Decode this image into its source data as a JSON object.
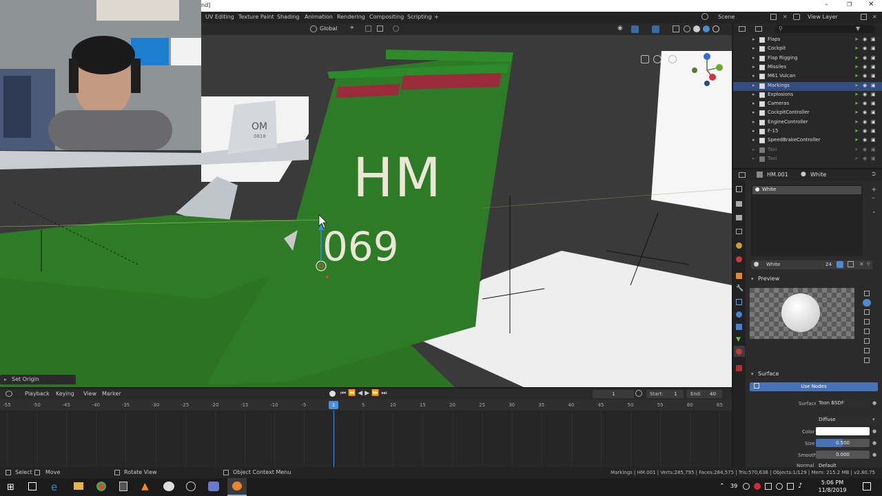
{
  "title_bar": {
    "text": "nd]"
  },
  "workspace_tabs": [
    "UV Editing",
    "Texture Paint",
    "Shading",
    "Animation",
    "Rendering",
    "Compositing",
    "Scripting",
    "+"
  ],
  "scene": {
    "scene_label": "Scene",
    "view_layer_label": "View Layer"
  },
  "viewport_header": {
    "orientation": "Global"
  },
  "viewport": {
    "decal_top": "HM",
    "decal_bottom": "069",
    "background_decal": "OM",
    "background_decal_small": "0818",
    "operator_panel": "Set Origin",
    "colors": {
      "wing_green": "#2f7a27",
      "tail_green": "#2d7a27",
      "stripe_red": "#9b2a3a",
      "decal_cream": "#ece6d6"
    }
  },
  "outliner": {
    "items": [
      {
        "label": "Flaps",
        "selected": false
      },
      {
        "label": "Cockpit",
        "selected": false
      },
      {
        "label": "Flap Rigging",
        "selected": false
      },
      {
        "label": "Missiles",
        "selected": false
      },
      {
        "label": "M61 Vulcan",
        "selected": false
      },
      {
        "label": "Markings",
        "selected": true
      },
      {
        "label": "Explosions",
        "selected": false
      },
      {
        "label": "Cameras",
        "selected": false
      },
      {
        "label": "CockpitController",
        "selected": false
      },
      {
        "label": "EngineController",
        "selected": false
      },
      {
        "label": "F-15",
        "selected": false
      },
      {
        "label": "SpeedBrakeController",
        "selected": false
      },
      {
        "label": "Taxi",
        "selected": false
      },
      {
        "label": "Taxi",
        "selected": false
      }
    ]
  },
  "properties": {
    "object_name": "HM.001",
    "material_name": "White",
    "slot_name": "White",
    "material_field": "White",
    "user_count": "24",
    "preview_label": "Preview",
    "surface_label": "Surface",
    "use_nodes_label": "Use Nodes",
    "surface_field_label": "Surface",
    "surface_value": "Toon BSDF",
    "component_value": "Diffuse",
    "color_label": "Color",
    "color_value": "#ffffff",
    "size_label": "Size",
    "size_value": "0.500",
    "size_fraction": 0.5,
    "smooth_label": "Smooth",
    "smooth_value": "0.000",
    "normal_label": "Normal",
    "normal_value": "Default"
  },
  "timeline": {
    "menus": [
      "Playback",
      "Keying",
      "View",
      "Marker"
    ],
    "current_frame": "1",
    "start_label": "Start:",
    "start_value": "1",
    "end_label": "End:",
    "end_value": "40",
    "ticks": [
      "-55",
      "-50",
      "-45",
      "-40",
      "-35",
      "-30",
      "-25",
      "-20",
      "-15",
      "-10",
      "-5",
      "1",
      "5",
      "10",
      "15",
      "20",
      "25",
      "30",
      "35",
      "40",
      "45",
      "50",
      "55",
      "60",
      "65"
    ],
    "playhead_frame": "1"
  },
  "status_bar": {
    "select_label": "Select",
    "move_label": "Move",
    "rotate_label": "Rotate View",
    "context_menu_label": "Object Context Menu",
    "stats": "Markings | HM.001 | Verts:285,795 | Faces:284,575 | Tris:570,638 | Objects:1/129 | Mem: 215.2 MB | v2.80.75"
  },
  "taskbar": {
    "temperature": "39",
    "time": "5:06 PM",
    "date": "11/8/2019"
  }
}
